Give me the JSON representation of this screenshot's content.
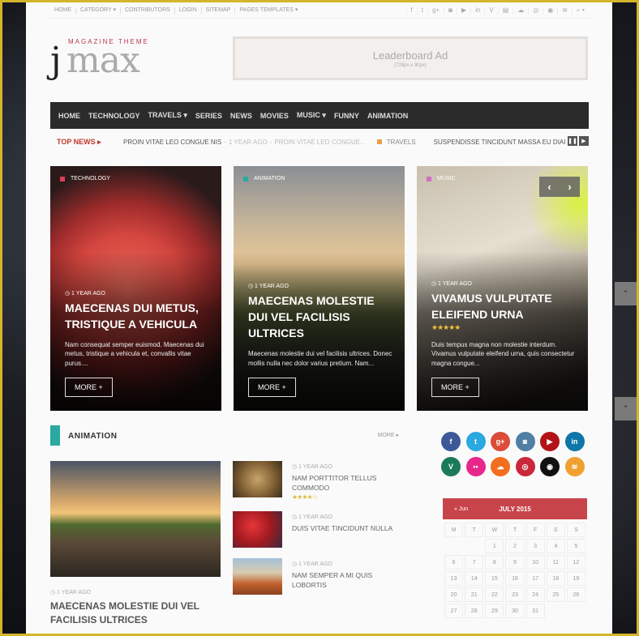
{
  "topbar": {
    "links": [
      "HOME",
      "CATEGORY ▾",
      "CONTRIBUTORS",
      "LOGIN",
      "SITEMAP",
      "PAGES TEMPLATES ▾"
    ],
    "social_icons": [
      "facebook-icon",
      "twitter-icon",
      "google-plus-icon",
      "instagram-icon",
      "youtube-icon",
      "linkedin-icon",
      "vine-icon",
      "flickr-icon",
      "soundcloud-icon",
      "dribbble-icon",
      "github-icon",
      "rss-icon",
      "search-icon"
    ],
    "social_glyphs": [
      "f",
      "t",
      "g+",
      "◙",
      "▶",
      "in",
      "V",
      "▤",
      "☁",
      "◎",
      "◉",
      "≋",
      "⌕ ▾"
    ]
  },
  "header": {
    "logo_tagline": "MAGAZINE THEME",
    "logo_j": "j",
    "logo_max": "max",
    "ad_title": "Leaderboard Ad",
    "ad_size": "(728px x 90px)"
  },
  "nav": {
    "items": [
      "HOME",
      "TECHNOLOGY",
      "TRAVELS ▾",
      "SERIES",
      "NEWS",
      "MOVIES",
      "MUSIC ▾",
      "FUNNY",
      "ANIMATION"
    ]
  },
  "ticker": {
    "label": "TOP NEWS ▸",
    "headline1": "PROIN VITAE LEO CONGUE NIS",
    "meta1": "1 YEAR AGO",
    "excerpt1": "PROIN VITAE LEO CONGUE...",
    "category": "TRAVELS",
    "category_color": "#e8a04a",
    "headline2": "SUSPENDISSE TINCIDUNT MASSA EU DIAI",
    "pause": "❚❚",
    "next": "▶"
  },
  "features": [
    {
      "category": "TECHNOLOGY",
      "category_color": "#e0405a",
      "time": "◷ 1 YEAR AGO",
      "title": "MAECENAS DUI METUS, TRISTIQUE A VEHICULA",
      "desc": "Nam consequat semper euismod. Maecenas dui metus, tristique a vehicula et, convallis vitae purus....",
      "more": "MORE +"
    },
    {
      "category": "ANIMATION",
      "category_color": "#2aa8a2",
      "time": "◷ 1 YEAR AGO",
      "title": "MAECENAS MOLESTIE DUI VEL FACILISIS ULTRICES",
      "desc": "Maecenas molestie dui vel facilisis ultrices. Donec mollis nulla nec dolor varius pretium. Nam...",
      "more": "MORE +"
    },
    {
      "category": "MUSIC",
      "category_color": "#d070c0",
      "time": "◷ 1 YEAR AGO",
      "title": "VIVAMUS VULPUTATE ELEIFEND URNA",
      "rating": "4.5 of 5",
      "stars": "★★★★★",
      "desc": "Duis tempus magna non molestie interdum. Vivamus vulputate eleifend urna, quis consectetur magna congue...",
      "more": "MORE +"
    }
  ],
  "slider": {
    "prev": "‹",
    "next": "›"
  },
  "section": {
    "title": "ANIMATION",
    "more": "MORE ▸",
    "accent": "#2aa8a2",
    "main_post": {
      "time": "◷ 1 YEAR AGO",
      "title": "MAECENAS MOLESTIE DUI VEL FACILISIS ULTRICES"
    },
    "list": [
      {
        "time": "◷ 1 YEAR AGO",
        "title": "NAM PORTTITOR TELLUS COMMODO",
        "stars": "★★★★☆",
        "rating": "4 of 5"
      },
      {
        "time": "◷ 1 YEAR AGO",
        "title": "DUIS VITAE TINCIDUNT NULLA"
      },
      {
        "time": "◷ 1 YEAR AGO",
        "title": "NAM SEMPER A MI QUIS LOBORTIS"
      }
    ]
  },
  "social_buttons": [
    {
      "name": "facebook",
      "glyph": "f",
      "color": "#3b5998"
    },
    {
      "name": "twitter",
      "glyph": "t",
      "color": "#2aa9e0"
    },
    {
      "name": "google-plus",
      "glyph": "g+",
      "color": "#dd4b39"
    },
    {
      "name": "instagram",
      "glyph": "◙",
      "color": "#517fa4"
    },
    {
      "name": "youtube",
      "glyph": "▶",
      "color": "#b31217"
    },
    {
      "name": "linkedin",
      "glyph": "in",
      "color": "#0e76a8"
    },
    {
      "name": "vine",
      "glyph": "V",
      "color": "#1a7a5a"
    },
    {
      "name": "flickr",
      "glyph": "••",
      "color": "#e8278a"
    },
    {
      "name": "soundcloud",
      "glyph": "☁",
      "color": "#f26f1f"
    },
    {
      "name": "dribbble",
      "glyph": "◎",
      "color": "#c9283a"
    },
    {
      "name": "github",
      "glyph": "◉",
      "color": "#111111"
    },
    {
      "name": "rss",
      "glyph": "≋",
      "color": "#f0a030"
    }
  ],
  "calendar": {
    "prev": "« Jun",
    "month": "JULY 2015",
    "weekdays": [
      "M",
      "T",
      "W",
      "T",
      "F",
      "S",
      "S"
    ],
    "weeks": [
      [
        "",
        "",
        "1",
        "2",
        "3",
        "4",
        "5"
      ],
      [
        "6",
        "7",
        "8",
        "9",
        "10",
        "11",
        "12"
      ],
      [
        "13",
        "14",
        "15",
        "16",
        "17",
        "18",
        "19"
      ],
      [
        "20",
        "21",
        "22",
        "23",
        "24",
        "25",
        "26"
      ],
      [
        "27",
        "28",
        "29",
        "30",
        "31",
        "",
        ""
      ]
    ],
    "header_color": "#c8444b"
  },
  "side_buttons": {
    "up": "⌃"
  }
}
